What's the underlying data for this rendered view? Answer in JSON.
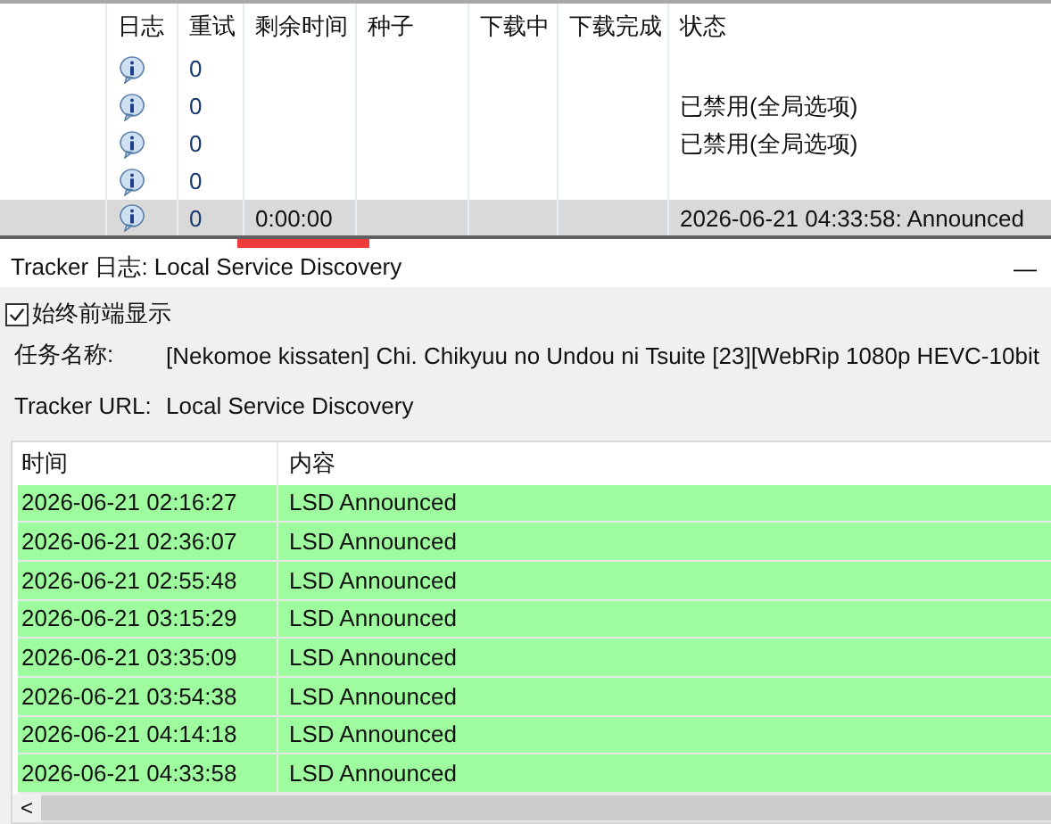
{
  "peers_table": {
    "columns": [
      "",
      "日志",
      "重试",
      "剩余时间",
      "种子",
      "下载中",
      "下载完成",
      "状态"
    ],
    "rows": [
      {
        "retry": "0",
        "remaining": "",
        "status": "",
        "selected": false
      },
      {
        "retry": "0",
        "remaining": "",
        "status": "已禁用(全局选项)",
        "selected": false
      },
      {
        "retry": "0",
        "remaining": "",
        "status": "已禁用(全局选项)",
        "selected": false
      },
      {
        "retry": "0",
        "remaining": "",
        "status": "",
        "selected": false
      },
      {
        "retry": "0",
        "remaining": "0:00:00",
        "status": "2026-06-21 04:33:58: Announced",
        "selected": true
      }
    ]
  },
  "log_window": {
    "title": "Tracker 日志: Local Service Discovery",
    "minimize": "—",
    "always_on_top": {
      "label": "始终前端显示",
      "checked": true
    },
    "fields": [
      {
        "label": "任务名称:",
        "value": "[Nekomoe kissaten] Chi. Chikyuu no Undou ni Tsuite [23][WebRip 1080p HEVC-10bit"
      },
      {
        "label": "Tracker URL:",
        "value": "Local Service Discovery"
      }
    ],
    "log_table": {
      "columns": [
        "时间",
        "内容"
      ],
      "rows": [
        {
          "time": "2026-06-21 02:16:27",
          "content": "LSD Announced"
        },
        {
          "time": "2026-06-21 02:36:07",
          "content": "LSD Announced"
        },
        {
          "time": "2026-06-21 02:55:48",
          "content": "LSD Announced"
        },
        {
          "time": "2026-06-21 03:15:29",
          "content": "LSD Announced"
        },
        {
          "time": "2026-06-21 03:35:09",
          "content": "LSD Announced"
        },
        {
          "time": "2026-06-21 03:54:38",
          "content": "LSD Announced"
        },
        {
          "time": "2026-06-21 04:14:18",
          "content": "LSD Announced"
        },
        {
          "time": "2026-06-21 04:33:58",
          "content": "LSD Announced"
        }
      ]
    },
    "scroll_left": "<"
  }
}
